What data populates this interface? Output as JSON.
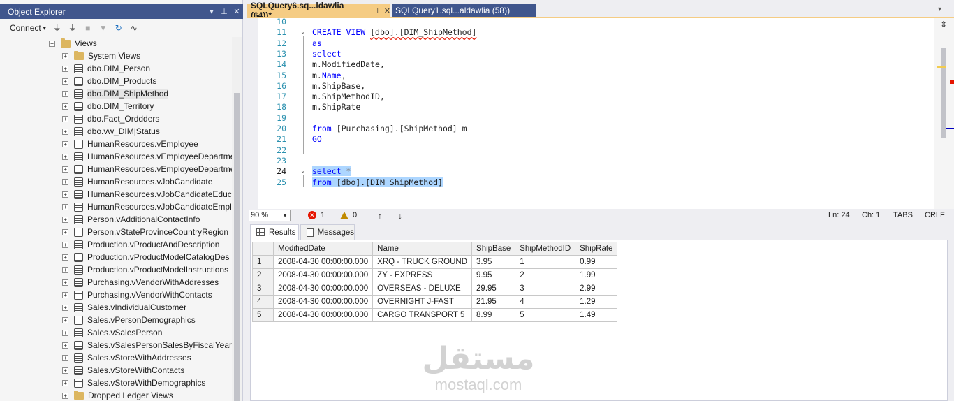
{
  "object_explorer": {
    "title": "Object Explorer",
    "connect_label": "Connect",
    "root_label": "Views",
    "items": [
      {
        "label": "System Views",
        "type": "folder"
      },
      {
        "label": "dbo.DIM_Person",
        "type": "view"
      },
      {
        "label": "dbo.DIM_Products",
        "type": "view"
      },
      {
        "label": "dbo.DIM_ShipMethod",
        "type": "view",
        "selected": true
      },
      {
        "label": "dbo.DIM_Territory",
        "type": "view"
      },
      {
        "label": "dbo.Fact_Orddders",
        "type": "view"
      },
      {
        "label": "dbo.vw_DIM|Status",
        "type": "view"
      },
      {
        "label": "HumanResources.vEmployee",
        "type": "view"
      },
      {
        "label": "HumanResources.vEmployeeDepartme",
        "type": "view"
      },
      {
        "label": "HumanResources.vEmployeeDepartme",
        "type": "view"
      },
      {
        "label": "HumanResources.vJobCandidate",
        "type": "view"
      },
      {
        "label": "HumanResources.vJobCandidateEduca",
        "type": "view"
      },
      {
        "label": "HumanResources.vJobCandidateEmplo",
        "type": "view"
      },
      {
        "label": "Person.vAdditionalContactInfo",
        "type": "view"
      },
      {
        "label": "Person.vStateProvinceCountryRegion",
        "type": "view"
      },
      {
        "label": "Production.vProductAndDescription",
        "type": "view"
      },
      {
        "label": "Production.vProductModelCatalogDes",
        "type": "view"
      },
      {
        "label": "Production.vProductModelInstructions",
        "type": "view"
      },
      {
        "label": "Purchasing.vVendorWithAddresses",
        "type": "view"
      },
      {
        "label": "Purchasing.vVendorWithContacts",
        "type": "view"
      },
      {
        "label": "Sales.vIndividualCustomer",
        "type": "view"
      },
      {
        "label": "Sales.vPersonDemographics",
        "type": "view"
      },
      {
        "label": "Sales.vSalesPerson",
        "type": "view"
      },
      {
        "label": "Sales.vSalesPersonSalesByFiscalYears",
        "type": "view"
      },
      {
        "label": "Sales.vStoreWithAddresses",
        "type": "view"
      },
      {
        "label": "Sales.vStoreWithContacts",
        "type": "view"
      },
      {
        "label": "Sales.vStoreWithDemographics",
        "type": "view"
      },
      {
        "label": "Dropped Ledger Views",
        "type": "folder"
      }
    ]
  },
  "tabs": [
    {
      "label": "SQLQuery6.sq...ldawlia (64))*",
      "active": true
    },
    {
      "label": "SQLQuery1.sql...aldawlia (58))",
      "active": false
    }
  ],
  "editor": {
    "line_numbers": [
      "10",
      "11",
      "12",
      "13",
      "14",
      "15",
      "16",
      "17",
      "18",
      "19",
      "20",
      "21",
      "22",
      "23",
      "24",
      "25"
    ],
    "current_line": "24",
    "code": {
      "l11_kw": "CREATE VIEW",
      "l11_obj": "[dbo].[DIM_ShipMethod]",
      "l12": "as",
      "l13": "select",
      "l14_a": "m.",
      "l14_b": "ModifiedDate,",
      "l15_a": "m.",
      "l15_b": "Name",
      "l15_c": ",",
      "l16_a": "m.",
      "l16_b": "ShipBase,",
      "l17_a": "m.",
      "l17_b": "ShipMethodID,",
      "l18_a": "m.",
      "l18_b": "ShipRate",
      "l20_kw": "from",
      "l20_obj": "[Purchasing].[ShipMethod] m",
      "l21": "GO",
      "l24_kw": "select",
      "l24_star": " *",
      "l25_kw": "from",
      "l25_obj": " [dbo].[DIM_ShipMethod]"
    }
  },
  "status": {
    "zoom": "90 %",
    "errors": "1",
    "warnings": "0",
    "ln": "Ln: 24",
    "ch": "Ch: 1",
    "mode": "TABS",
    "eol": "CRLF"
  },
  "results": {
    "tab_results": "Results",
    "tab_messages": "Messages",
    "columns": [
      "ModifiedDate",
      "Name",
      "ShipBase",
      "ShipMethodID",
      "ShipRate"
    ],
    "rows": [
      [
        "1",
        "2008-04-30 00:00:00.000",
        "XRQ - TRUCK GROUND",
        "3.95",
        "1",
        "0.99"
      ],
      [
        "2",
        "2008-04-30 00:00:00.000",
        "ZY - EXPRESS",
        "9.95",
        "2",
        "1.99"
      ],
      [
        "3",
        "2008-04-30 00:00:00.000",
        "OVERSEAS - DELUXE",
        "29.95",
        "3",
        "2.99"
      ],
      [
        "4",
        "2008-04-30 00:00:00.000",
        "OVERNIGHT J-FAST",
        "21.95",
        "4",
        "1.29"
      ],
      [
        "5",
        "2008-04-30 00:00:00.000",
        "CARGO TRANSPORT 5",
        "8.99",
        "5",
        "1.49"
      ]
    ]
  },
  "watermark": {
    "arabic": "مستقل",
    "latin": "mostaql.com"
  },
  "colors": {
    "title_bar": "#40568d",
    "active_tab": "#f5cc84",
    "keyword": "#0000ff",
    "selection": "#add6ff",
    "line_number": "#2b91af"
  }
}
